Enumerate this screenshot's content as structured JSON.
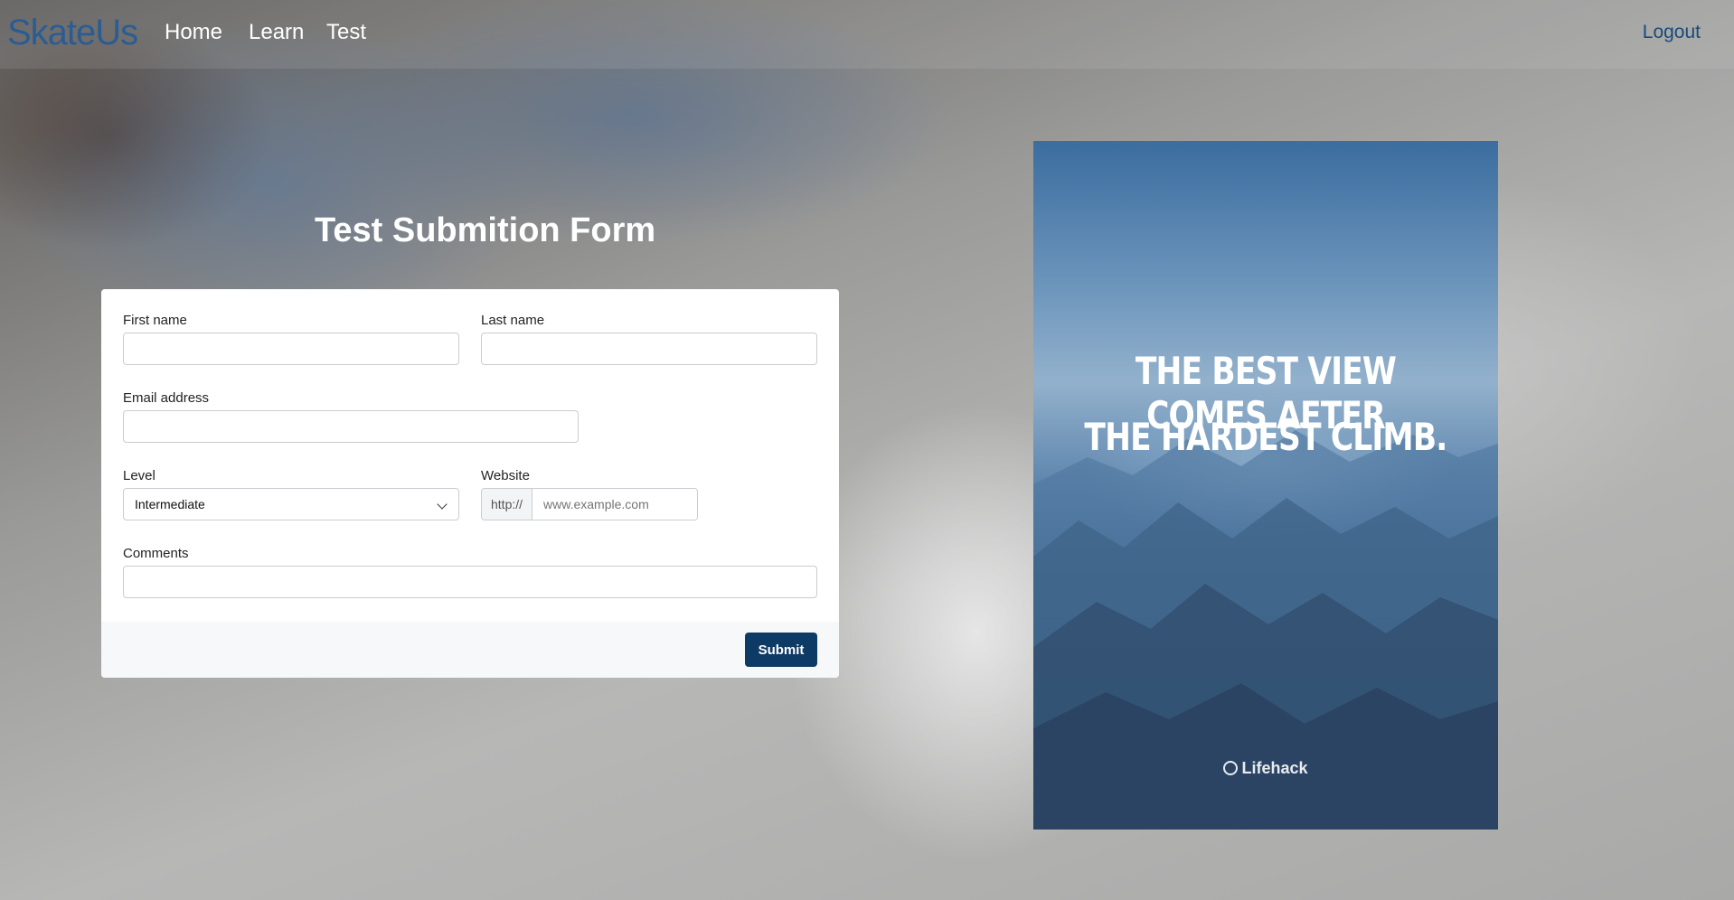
{
  "nav": {
    "brand": "SkateUs",
    "home": "Home",
    "learn": "Learn",
    "test": "Test",
    "logout": "Logout"
  },
  "form": {
    "title": "Test Submition Form",
    "first_name_label": "First name",
    "first_name_value": "",
    "last_name_label": "Last name",
    "last_name_value": "",
    "email_label": "Email address",
    "email_value": "",
    "level_label": "Level",
    "level_value": "Intermediate",
    "website_label": "Website",
    "website_prefix": "http://",
    "website_placeholder": "www.example.com",
    "comments_label": "Comments",
    "comments_value": "",
    "submit_label": "Submit"
  },
  "poster": {
    "quote_line1": "THE BEST VIEW COMES AFTER",
    "quote_line2": "THE HARDEST CLIMB.",
    "credit": "Lifehack"
  },
  "colors": {
    "brand": "#1e5a9a",
    "submit_bg": "#0e3a66",
    "logout": "#1a4a7a"
  }
}
